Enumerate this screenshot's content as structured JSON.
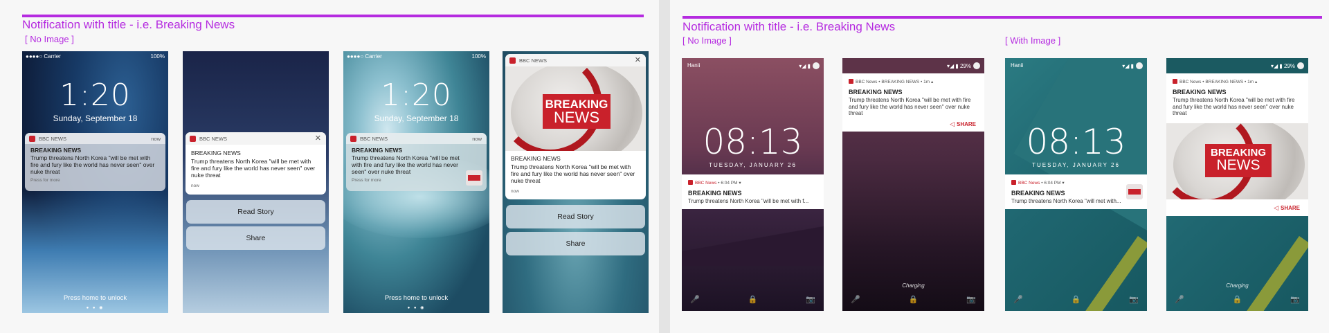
{
  "ios_panel": {
    "title": "Notification with title - i.e. Breaking News",
    "subtitle": "[ No Image ]"
  },
  "android_panel": {
    "title": "Notification with title - i.e. Breaking News",
    "subtitle_left": "[ No Image ]",
    "subtitle_right": "[ With Image ]"
  },
  "notification": {
    "app": "BBC NEWS",
    "time": "now",
    "title": "BREAKING NEWS",
    "body": "Trump threatens North Korea \"will be met with fire and fury like the world has never seen\" over nuke threat",
    "press_more": "Press for more",
    "close": "✕"
  },
  "ios": {
    "carrier": "●●●●○ Carrier",
    "battery": "100%",
    "time": "1:20",
    "date": "Sunday, September 18",
    "read_story": "Read Story",
    "share": "Share",
    "unlock": "Press home to unlock",
    "dots": "● ● ◉"
  },
  "breaking_graphic": {
    "line1": "BREAKING",
    "line2": "NEWS"
  },
  "android": {
    "user": "Hanii",
    "status_icons": "▾◢ ▮",
    "battery": "29%",
    "clock": "08:13",
    "date": "TUESDAY, JANUARY 26",
    "meta_app": "BBC News",
    "meta_time": " • 6:04 PM ▾",
    "meta_expanded_app": "BBC News",
    "meta_expanded_rest": " • BREAKING NEWS • 1m ▴",
    "collapsed_body": "Trump threatens North Korea \"will be met with f...",
    "collapsed_body_img": "Trump threatens North Korea \"will met with...",
    "share": "SHARE",
    "share_icon": "◁",
    "charging": "Charging",
    "mic_icon": "🎤",
    "lock_icon": "🔒",
    "camera_icon": "📷"
  },
  "colors": {
    "accent": "#b52be0",
    "bbc_red": "#c9212b",
    "teal": "#1f6f74",
    "plum": "#5a2e45"
  }
}
